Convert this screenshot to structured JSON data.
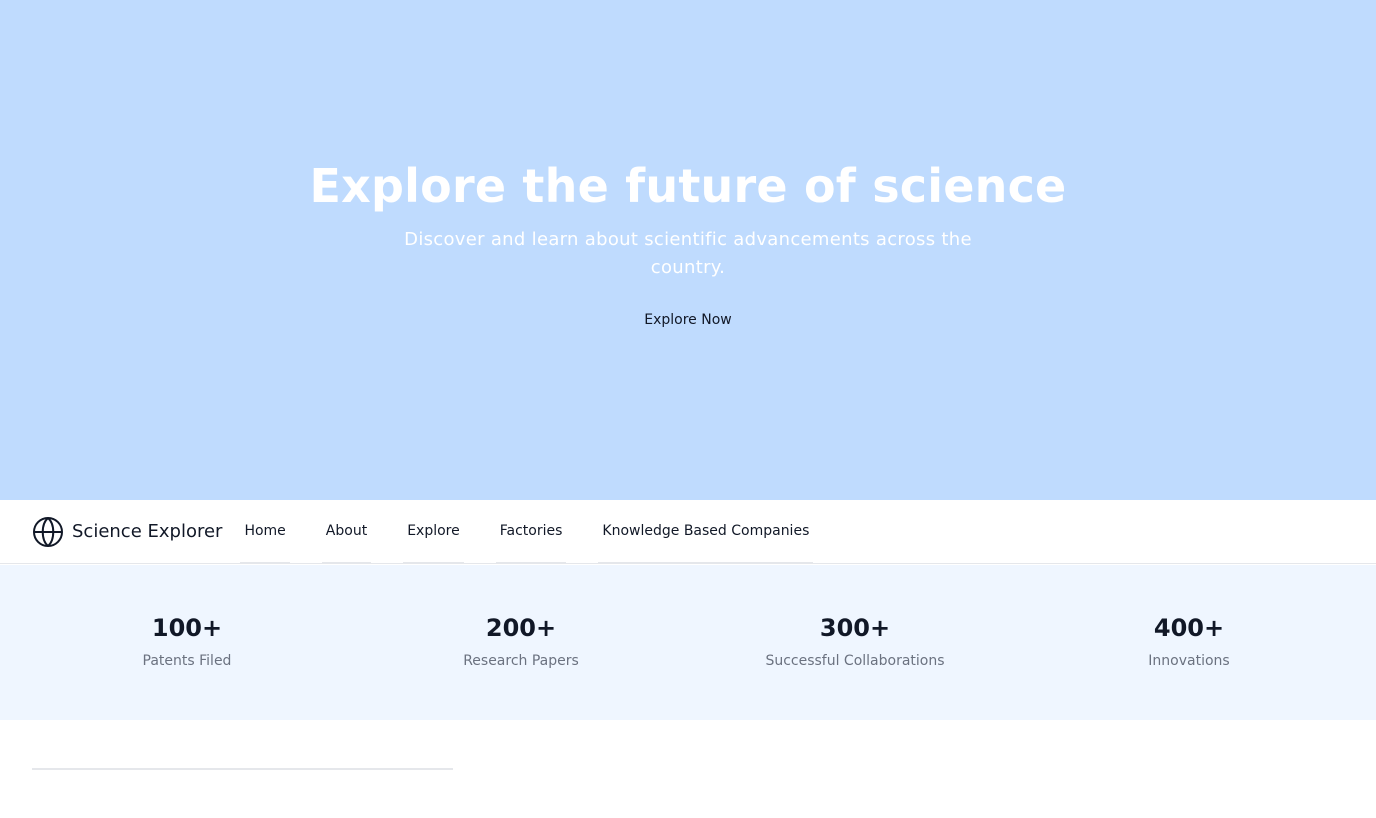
{
  "hero": {
    "title": "Explore the future of science",
    "subtitle": "Discover and learn about scientific advancements across the country.",
    "cta_label": "Explore Now",
    "background_color": "#bfdbfe"
  },
  "navbar": {
    "brand_icon": "globe-icon",
    "brand_name": "Science Explorer",
    "items": [
      {
        "label": "Home"
      },
      {
        "label": "About"
      },
      {
        "label": "Explore"
      },
      {
        "label": "Factories"
      },
      {
        "label": "Knowledge Based Companies"
      }
    ]
  },
  "stats": {
    "background_color": "#eff6ff",
    "items": [
      {
        "value": "100+",
        "label": "Patents Filed"
      },
      {
        "value": "200+",
        "label": "Research Papers"
      },
      {
        "value": "300+",
        "label": "Successful Collaborations"
      },
      {
        "value": "400+",
        "label": "Innovations"
      }
    ]
  }
}
